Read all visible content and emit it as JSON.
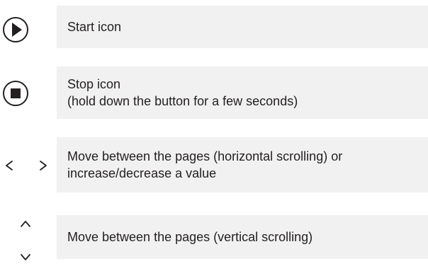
{
  "rows": [
    {
      "icon": "play-circle-icon",
      "lines": [
        "Start icon"
      ]
    },
    {
      "icon": "stop-circle-icon",
      "lines": [
        "Stop icon",
        "(hold down the button for a few seconds)"
      ]
    },
    {
      "icon": "chevron-left-right-icons",
      "lines": [
        "Move between the pages (horizontal scrolling) or",
        "increase/decrease a value"
      ]
    },
    {
      "icon": "chevron-up-down-icons",
      "lines": [
        "Move between the pages (vertical scrolling)"
      ]
    }
  ],
  "colors": {
    "row_background": "#f1f1f1",
    "icon": "#231f20",
    "text": "#231f20"
  }
}
